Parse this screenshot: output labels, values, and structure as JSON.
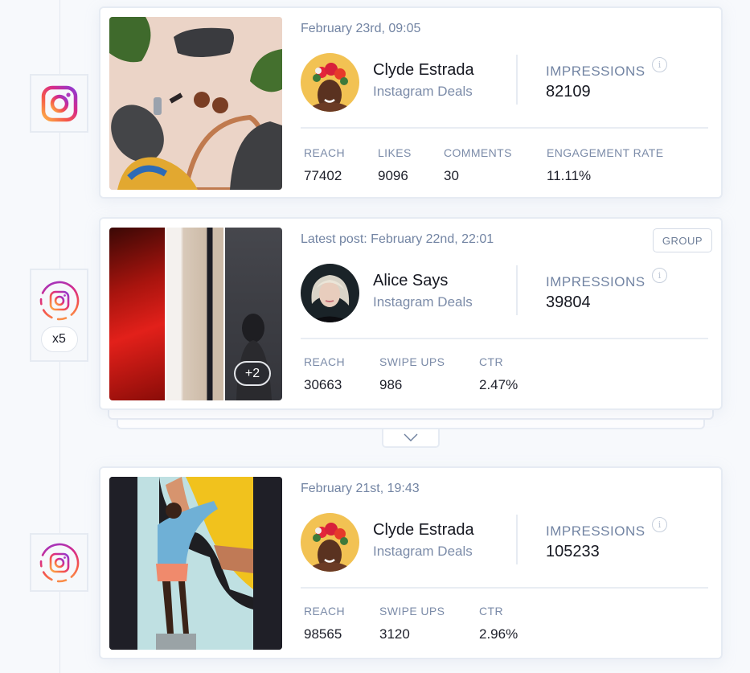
{
  "timeline": {
    "nodes": [
      {
        "icon": "instagram-post-icon"
      },
      {
        "icon": "instagram-story-icon",
        "count_label": "x5"
      },
      {
        "icon": "instagram-story-icon"
      }
    ]
  },
  "posts": [
    {
      "type": "post",
      "date": "February 23rd, 09:05",
      "author": "Clyde Estrada",
      "source": "Instagram Deals",
      "impressions_label": "IMPRESSIONS",
      "impressions": "82109",
      "stats": [
        {
          "label": "REACH",
          "value": "77402"
        },
        {
          "label": "LIKES",
          "value": "9096"
        },
        {
          "label": "COMMENTS",
          "value": "30"
        },
        {
          "label": "ENGAGEMENT RATE",
          "value": "11.11%"
        }
      ]
    },
    {
      "type": "story-group",
      "date": "Latest post: February 22nd, 22:01",
      "group_label": "GROUP",
      "extra_count": "+2",
      "author": "Alice Says",
      "source": "Instagram Deals",
      "impressions_label": "IMPRESSIONS",
      "impressions": "39804",
      "stats": [
        {
          "label": "REACH",
          "value": "30663"
        },
        {
          "label": "SWIPE UPS",
          "value": "986"
        },
        {
          "label": "CTR",
          "value": "2.47%"
        }
      ]
    },
    {
      "type": "story",
      "date": "February 21st, 19:43",
      "author": "Clyde Estrada",
      "source": "Instagram Deals",
      "impressions_label": "IMPRESSIONS",
      "impressions": "105233",
      "stats": [
        {
          "label": "REACH",
          "value": "98565"
        },
        {
          "label": "SWIPE UPS",
          "value": "3120"
        },
        {
          "label": "CTR",
          "value": "2.96%"
        }
      ]
    }
  ],
  "expand": {
    "icon": "chevron-down-icon"
  },
  "info": {
    "glyph": "i"
  },
  "colors": {
    "accent_text": "#7284a3",
    "instagram_gradient": [
      "#feda75",
      "#fa7e1e",
      "#d62976",
      "#962fbf",
      "#4f5bd5"
    ]
  }
}
